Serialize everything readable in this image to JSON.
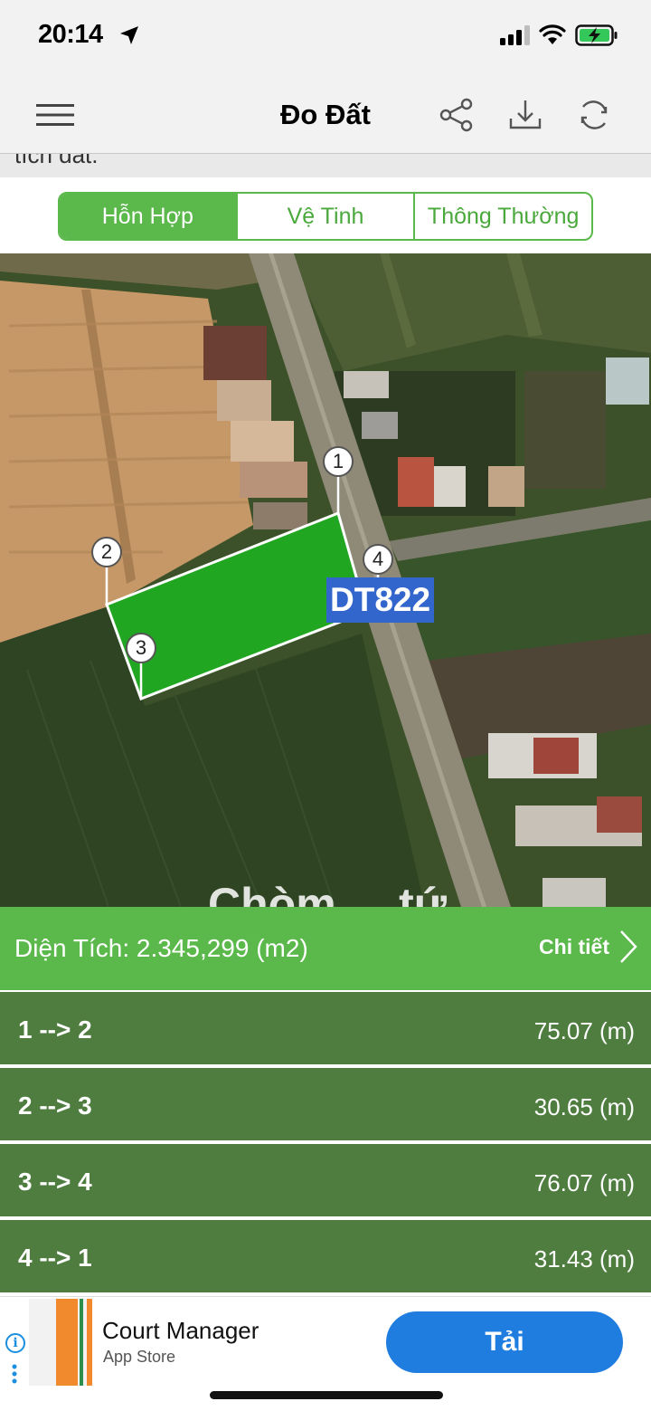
{
  "status_bar": {
    "time": "20:14"
  },
  "nav": {
    "title": "Đo Đất"
  },
  "clipped_text": "tích đất.",
  "map_types": {
    "tabs": [
      "Hỗn Hợp",
      "Vệ Tinh",
      "Thông Thường"
    ],
    "selected": "Hỗn Hợp"
  },
  "map": {
    "road_label": "DT822",
    "markers": [
      "1",
      "2",
      "3",
      "4"
    ],
    "partial_label": "Chòm ... tứ ..."
  },
  "area": {
    "label": "Diện Tích: 2.345,299 (m2)",
    "details": "Chi tiết"
  },
  "segments": [
    {
      "name": "1 --> 2",
      "length": "75.07 (m)"
    },
    {
      "name": "2 --> 3",
      "length": "30.65 (m)"
    },
    {
      "name": "3 --> 4",
      "length": "76.07 (m)"
    },
    {
      "name": "4 --> 1",
      "length": "31.43 (m)"
    }
  ],
  "ad": {
    "app_name": "Court Manager",
    "store": "App Store",
    "cta": "Tải"
  },
  "colors": {
    "accent": "#5bb84b",
    "row": "#4e7d3f",
    "cta": "#1f7de0",
    "road_label_bg": "#3366cc"
  }
}
